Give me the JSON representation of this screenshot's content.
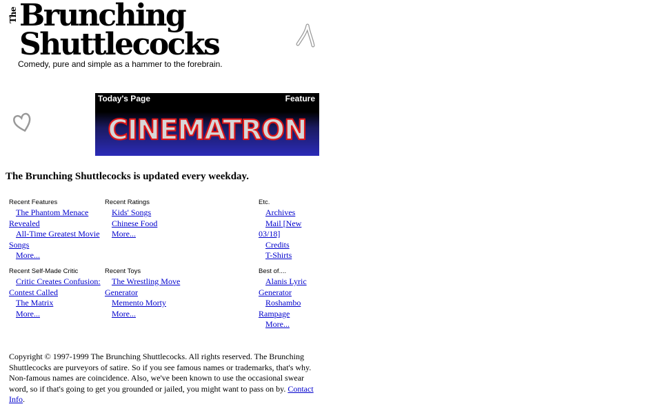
{
  "logo": {
    "the": "The",
    "line1": "Brunching",
    "line2": "Shuttlecocks",
    "tagline": "Comedy, pure and simple as a hammer to the forebrain."
  },
  "icons": {
    "wishbone": "wishbone-icon",
    "heart": "heart-icon"
  },
  "banner": {
    "left_label": "Today's Page",
    "right_label": "Feature",
    "title": "CINEMATRON"
  },
  "headline": "The Brunching Shuttlecocks is updated every weekday.",
  "sections": {
    "recent_features": {
      "heading": "Recent Features",
      "items": [
        "The Phantom Menace Revealed",
        "All-Time Greatest Movie Songs",
        "More..."
      ]
    },
    "recent_ratings": {
      "heading": "Recent Ratings",
      "items": [
        "Kids' Songs",
        "Chinese Food",
        "More..."
      ]
    },
    "etc": {
      "heading": "Etc.",
      "items": [
        "Archives",
        "Mail [New 03/18]",
        "Credits",
        "T-Shirts"
      ]
    },
    "self_made_critic": {
      "heading": "Recent Self-Made Critic",
      "items": [
        "Critic Creates Confusion: Contest Called",
        "The Matrix",
        "More..."
      ]
    },
    "recent_toys": {
      "heading": "Recent Toys",
      "items": [
        "The Wrestling Move Generator",
        "Memento Morty",
        "More..."
      ]
    },
    "best_of": {
      "heading": "Best of....",
      "items": [
        "Alanis Lyric Generator",
        "Roshambo Rampage",
        "More..."
      ]
    }
  },
  "copyright": {
    "text": "Copyright © 1997-1999 The Brunching Shuttlecocks. All rights reserved. The Brunching Shuttlecocks are purveyors of satire. So if you see famous names or trademarks, that's why. Non-famous names are coincidence. Also, we've been known to use the occasional swear word, so if that's going to get you grounded or jailed, you might want to pass on by.",
    "link": "Contact Info",
    "end": "."
  }
}
